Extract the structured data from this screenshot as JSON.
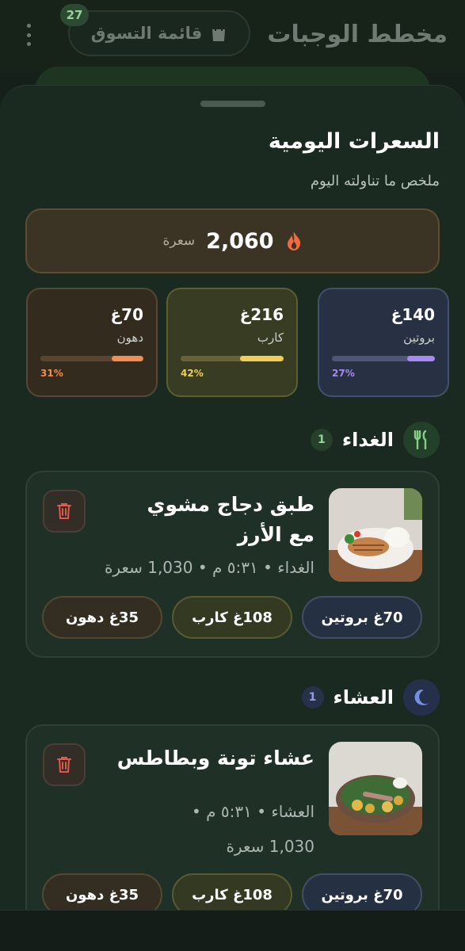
{
  "app": {
    "title": "مخطط الوجبات",
    "shopping_label": "قائمة التسوق",
    "shopping_count": "27"
  },
  "sheet": {
    "title": "السعرات اليومية",
    "subtitle": "ملخص ما تناولته اليوم",
    "calories_value": "2,060",
    "calories_unit": "سعرة"
  },
  "macros": {
    "protein": {
      "value": "140غ",
      "label": "بروتين",
      "percent": "27%",
      "fraction": 0.27,
      "color": "#a68af0"
    },
    "carb": {
      "value": "216غ",
      "label": "كارب",
      "percent": "42%",
      "fraction": 0.42,
      "color": "#f2ce55"
    },
    "fat": {
      "value": "70غ",
      "label": "دهون",
      "percent": "31%",
      "fraction": 0.31,
      "color": "#f28e52"
    }
  },
  "lunch": {
    "section_title": "الغداء",
    "count": "1",
    "meal": {
      "title": "طبق دجاج مشوي مع الأرز",
      "meta": "الغداء • ٥:٣١ م • 1,030 سعرة",
      "protein": "70غ بروتين",
      "carb": "108غ كارب",
      "fat": "35غ دهون"
    }
  },
  "dinner": {
    "section_title": "العشاء",
    "count": "1",
    "meal": {
      "title": "عشاء تونة وبطاطس",
      "meta_line1": "العشاء • ٥:٣١ م •",
      "meta_line2": "1,030 سعرة",
      "protein": "70غ بروتين",
      "carb": "108غ كارب",
      "fat": "35غ دهون"
    }
  }
}
